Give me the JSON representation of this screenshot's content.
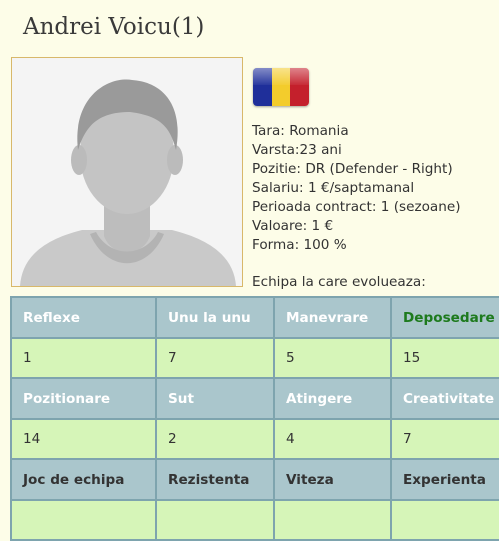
{
  "player": {
    "name": "Andrei Voicu(1)"
  },
  "flag": {
    "icon": "romania-flag-icon",
    "colors": [
      "#1f2f9a",
      "#f3cc2c",
      "#c4202c"
    ]
  },
  "info": {
    "lines": [
      "Tara: Romania",
      "Varsta:23 ani",
      "Pozitie: DR (Defender - Right)",
      "Salariu: 1 €/saptamanal",
      "Perioada contract: 1 (sezoane)",
      "Valoare: 1 €",
      "Forma: 100 %"
    ],
    "team_label": "Echipa la care evolueaza:"
  },
  "stats": {
    "highlight_color": "#1d7a1d",
    "rows": [
      {
        "labels": [
          "Reflexe",
          "Unu la unu",
          "Manevrare",
          "Deposedare"
        ],
        "values": [
          "1",
          "7",
          "5",
          "15"
        ]
      },
      {
        "labels": [
          "Pozitionare",
          "Sut",
          "Atingere",
          "Creativitate"
        ],
        "values": [
          "14",
          "2",
          "4",
          "7"
        ]
      },
      {
        "labels": [
          "Joc de echipa",
          "Rezistenta",
          "Viteza",
          "Experienta"
        ],
        "values": [
          "",
          "",
          "",
          ""
        ]
      }
    ]
  }
}
